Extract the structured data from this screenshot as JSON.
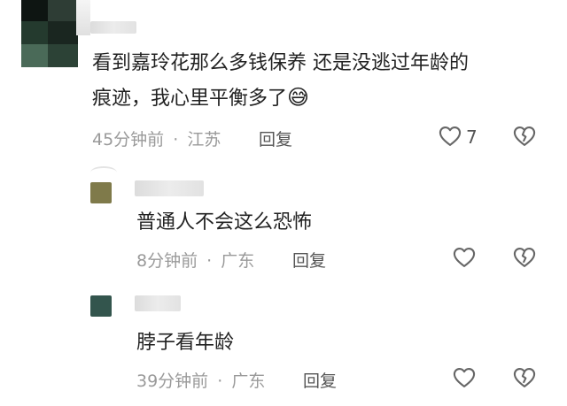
{
  "comments": [
    {
      "text_line1": "看到嘉玲花那么多钱保养 还是没逃过年龄的",
      "text_line2": "痕迹，我心里平衡多了",
      "emoji": "😅",
      "time": "45分钟前",
      "separator": "·",
      "location": "江苏",
      "reply_label": "回复",
      "like_count": "7"
    }
  ],
  "replies": [
    {
      "text": "普通人不会这么恐怖",
      "time": "8分钟前",
      "separator": "·",
      "location": "广东",
      "reply_label": "回复",
      "avatar_color": "#7f7a4a"
    },
    {
      "text": "脖子看年龄",
      "time": "39分钟前",
      "separator": "·",
      "location": "广东",
      "reply_label": "回复",
      "avatar_color": "#33554d"
    }
  ],
  "icons": {
    "like": "heart-outline-icon",
    "dislike": "broken-heart-icon"
  },
  "colors": {
    "meta_text": "#9a9a9a",
    "body_text": "#222222",
    "icon_stroke": "#666666"
  }
}
